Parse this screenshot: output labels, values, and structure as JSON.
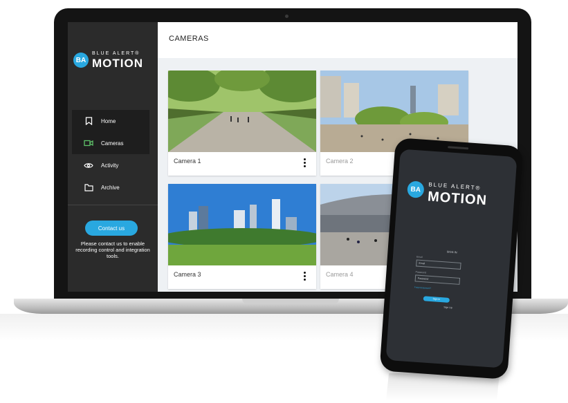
{
  "brand": {
    "top_text": "BLUE ALERT®",
    "main_text": "MOTION",
    "badge_text": "BA",
    "accent_color": "#29a8e0"
  },
  "sidebar": {
    "items": [
      {
        "label": "Home",
        "icon": "bookmark-icon"
      },
      {
        "label": "Cameras",
        "icon": "video-camera-icon"
      },
      {
        "label": "Activity",
        "icon": "eye-icon"
      },
      {
        "label": "Archive",
        "icon": "folder-icon"
      }
    ],
    "contact_button": "Contact us",
    "contact_text": "Please contact us to enable recording control and integration tools."
  },
  "page": {
    "title": "CAMERAS"
  },
  "cameras": [
    {
      "label": "Camera 1"
    },
    {
      "label": "Camera 2"
    },
    {
      "label": "Camera 3"
    },
    {
      "label": "Camera 4"
    }
  ],
  "phone": {
    "brand_top": "BLUE ALERT®",
    "brand_main": "MOTION",
    "signin_title": "SIGN IN",
    "email_label": "Email",
    "email_placeholder": "Email",
    "password_label": "Password",
    "password_placeholder": "Password",
    "forgot_link": "Forgot password?",
    "signin_button": "Sign in",
    "signup_link": "Sign Up"
  }
}
